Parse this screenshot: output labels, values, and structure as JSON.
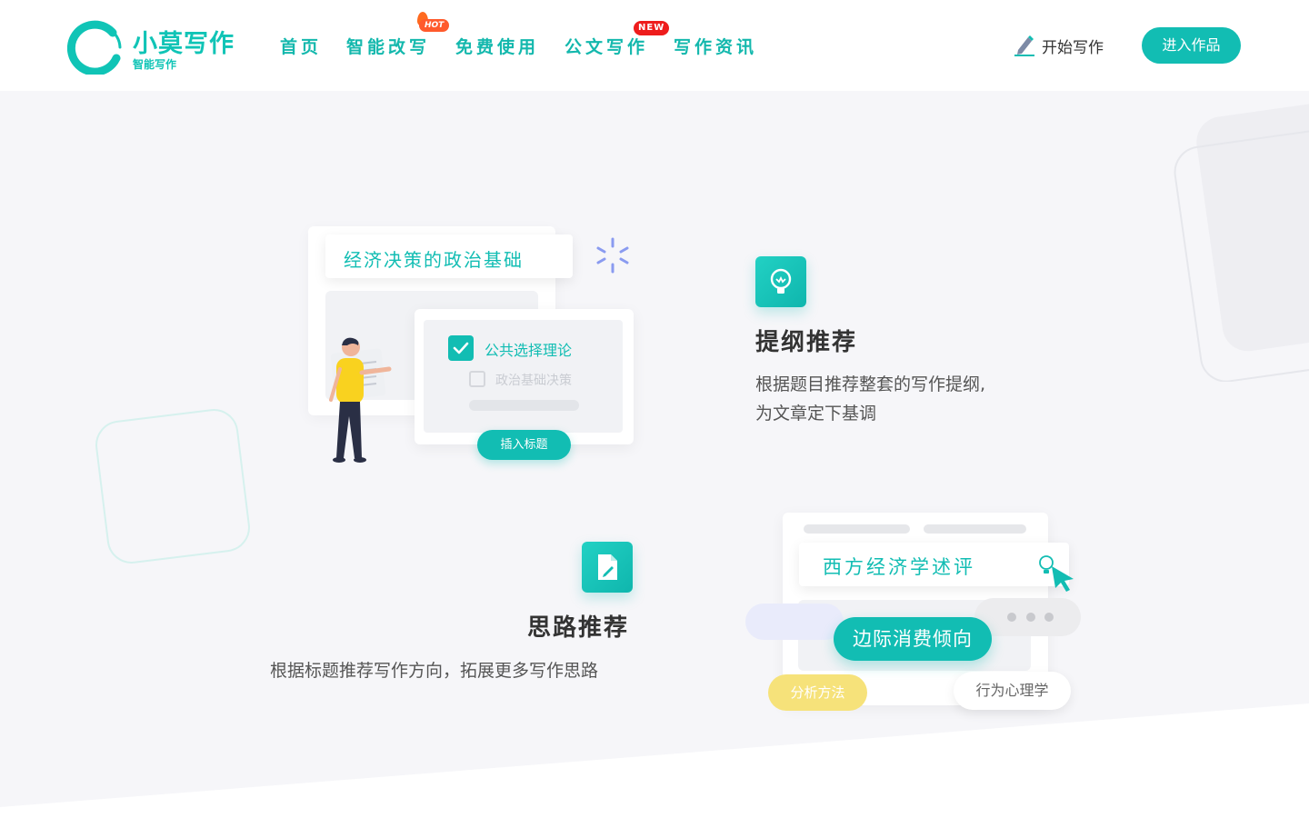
{
  "colors": {
    "accent": "#12bdb3",
    "hot_badge": "#ff5a2c",
    "new_badge": "#ee1c1c",
    "page_bg": "#f6f6f9",
    "tag_yellow": "#f6e27a",
    "tag_lavender": "#e9ebfb"
  },
  "header": {
    "logo": {
      "title": "小莫写作",
      "subtitle": "智能写作",
      "icon": "ring-logo-icon"
    },
    "nav": [
      {
        "label": "首页"
      },
      {
        "label": "智能改写",
        "badge": "HOT",
        "badge_icon": "flame-icon"
      },
      {
        "label": "免费使用"
      },
      {
        "label": "公文写作",
        "badge": "NEW"
      },
      {
        "label": "写作资讯"
      }
    ],
    "start_writing": {
      "label": "开始写作",
      "icon": "pen-icon"
    },
    "enter_button": "进入作品"
  },
  "feature_outline": {
    "title": "提纲推荐",
    "desc_line1": "根据题目推荐整套的写作提纲,",
    "desc_line2": "为文章定下基调",
    "icon": "lightbulb-icon",
    "illustration": {
      "topic": "经济决策的政治基础",
      "option_checked": "公共选择理论",
      "option_unchecked": "政治基础决策",
      "insert_button": "插入标题",
      "check_icon": "checkmark-icon"
    }
  },
  "feature_ideas": {
    "title": "思路推荐",
    "desc": "根据标题推荐写作方向，拓展更多写作思路",
    "icon": "edit-document-icon",
    "illustration": {
      "topic": "西方经济学述评",
      "main_tag": "边际消费倾向",
      "tag_left": "分析方法",
      "tag_right": "行为心理学",
      "cursor_icon": "bulb-cursor-icon"
    }
  }
}
